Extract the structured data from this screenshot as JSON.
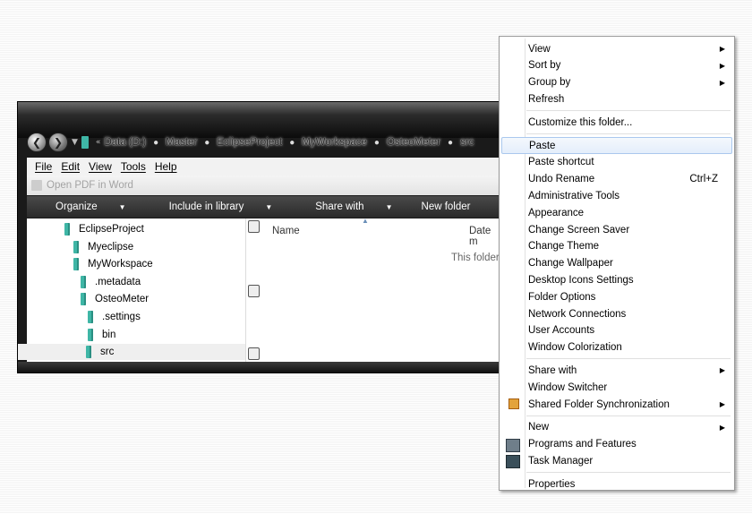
{
  "window": {
    "breadcrumb": [
      "Data (D:)",
      "Master",
      "EclipseProject",
      "MyWorkspace",
      "OsteoMeter",
      "src"
    ],
    "menubar": [
      "File",
      "Edit",
      "View",
      "Tools",
      "Help"
    ],
    "toolstrip_label": "Open PDF in Word",
    "commands": [
      "Organize",
      "Include in library",
      "Share with",
      "New folder"
    ],
    "tree": [
      {
        "label": "EclipseProject",
        "depth": 0
      },
      {
        "label": "Myeclipse",
        "depth": 1
      },
      {
        "label": "MyWorkspace",
        "depth": 1
      },
      {
        "label": ".metadata",
        "depth": 2
      },
      {
        "label": "OsteoMeter",
        "depth": 2
      },
      {
        "label": ".settings",
        "depth": 3
      },
      {
        "label": "bin",
        "depth": 3
      },
      {
        "label": "src",
        "depth": 3,
        "selected": true
      }
    ],
    "columns": {
      "name": "Name",
      "date": "Date m"
    },
    "empty_text": "This folder i"
  },
  "context_menu": {
    "items": [
      {
        "label": "View",
        "submenu": true
      },
      {
        "label": "Sort by",
        "submenu": true
      },
      {
        "label": "Group by",
        "submenu": true
      },
      {
        "label": "Refresh"
      },
      {
        "separator": true
      },
      {
        "label": "Customize this folder..."
      },
      {
        "separator": true
      },
      {
        "label": "Paste",
        "highlighted": true
      },
      {
        "label": "Paste shortcut"
      },
      {
        "label": "Undo Rename",
        "shortcut": "Ctrl+Z"
      },
      {
        "label": "Administrative Tools"
      },
      {
        "label": "Appearance"
      },
      {
        "label": "Change Screen Saver"
      },
      {
        "label": "Change Theme"
      },
      {
        "label": "Change Wallpaper"
      },
      {
        "label": "Desktop Icons Settings"
      },
      {
        "label": "Folder Options"
      },
      {
        "label": "Network Connections"
      },
      {
        "label": "User Accounts"
      },
      {
        "label": "Window Colorization"
      },
      {
        "separator": true
      },
      {
        "label": "Share with",
        "submenu": true
      },
      {
        "label": "Window Switcher"
      },
      {
        "label": "Shared Folder Synchronization",
        "submenu": true,
        "icon": "sync-icon"
      },
      {
        "separator": true
      },
      {
        "label": "New",
        "submenu": true
      },
      {
        "label": "Programs and Features",
        "icon": "programs-icon"
      },
      {
        "label": "Task Manager",
        "icon": "task-manager-icon"
      },
      {
        "separator": true
      },
      {
        "label": "Properties"
      }
    ]
  }
}
